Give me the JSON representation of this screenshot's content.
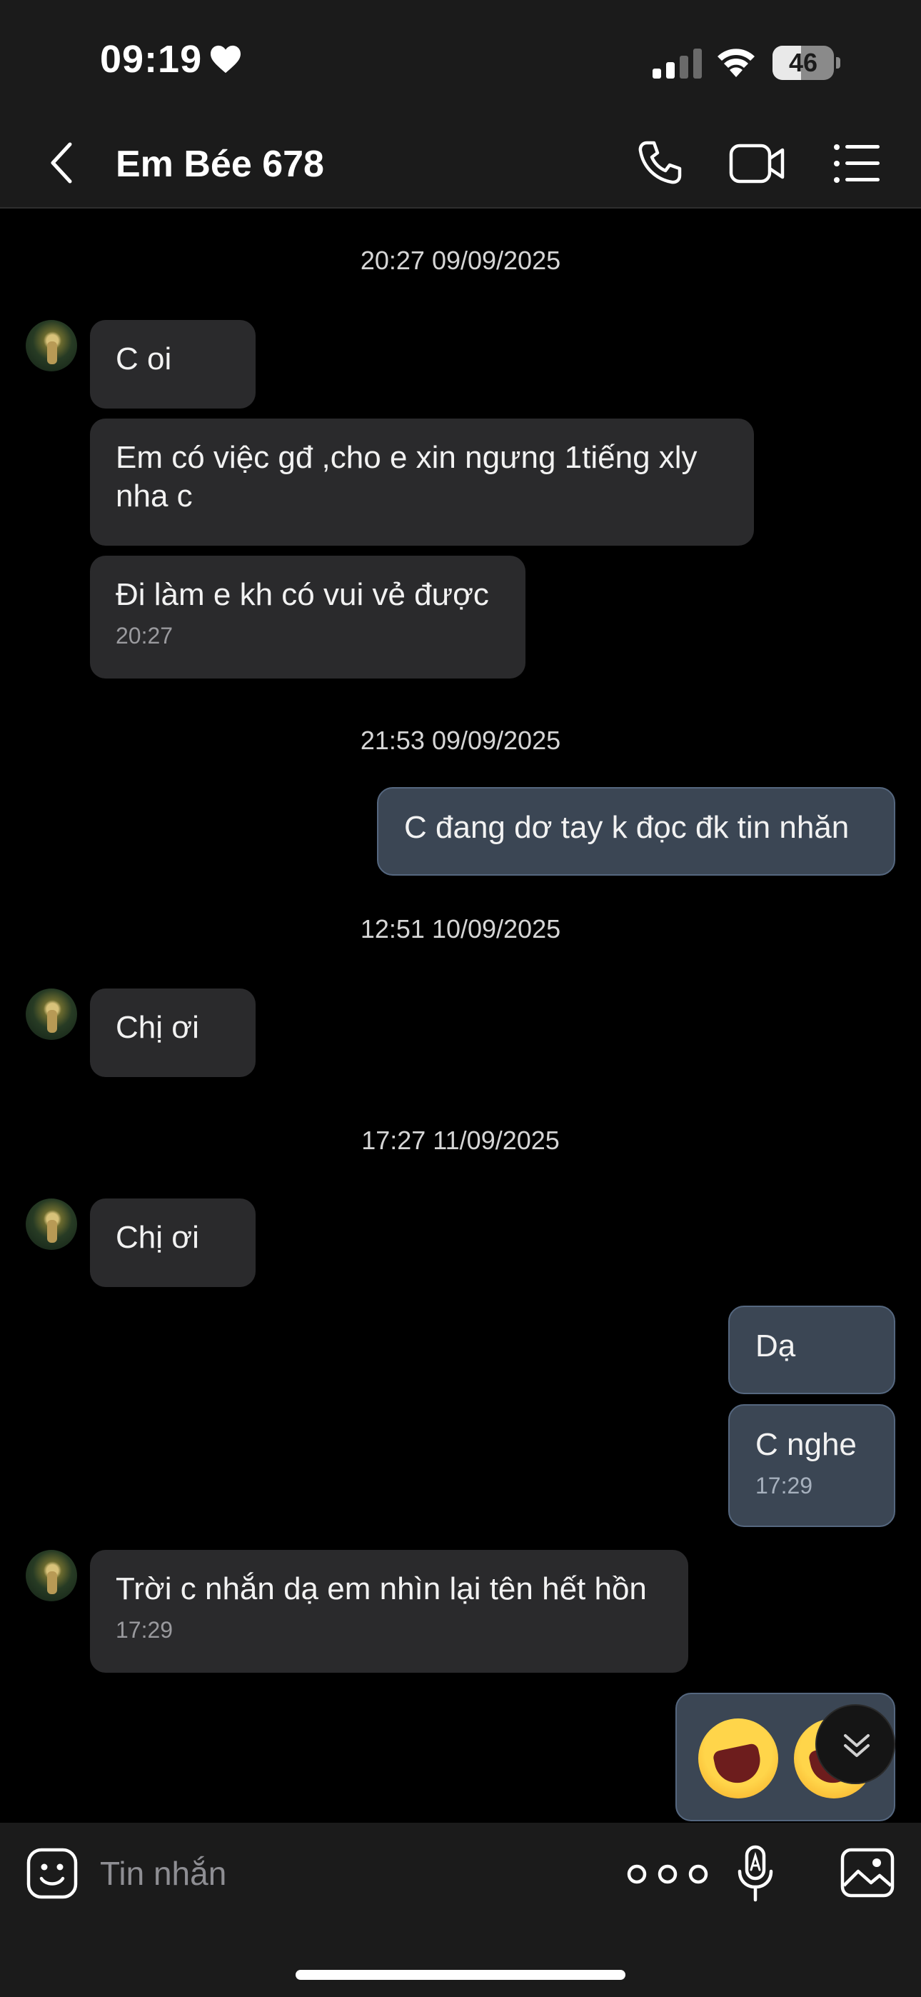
{
  "status_bar": {
    "time": "09:19",
    "battery": "46",
    "battery_level": 0.46
  },
  "header": {
    "title": "Em Bée 678"
  },
  "messages": [
    {
      "divider": "20:27 09/09/2025"
    },
    {
      "text": "C oi"
    },
    {
      "text": "Em có việc gđ ,cho e xin ngưng 1tiếng xly nha c"
    },
    {
      "text": "Đi làm e kh có vui vẻ được",
      "time": "20:27"
    },
    {
      "divider": "21:53 09/09/2025"
    },
    {
      "text": "C đang dơ tay k đọc đk tin nhăn"
    },
    {
      "divider": "12:51 10/09/2025"
    },
    {
      "text": "Chị ơi"
    },
    {
      "divider": "17:27 11/09/2025"
    },
    {
      "text": "Chị ơi"
    },
    {
      "text": "Dạ"
    },
    {
      "text": "C nghe",
      "time": "17:29"
    },
    {
      "text": "Trời c nhắn dạ em nhìn lại tên hết hồn",
      "time": "17:29"
    }
  ],
  "input": {
    "placeholder": "Tin nhắn"
  },
  "icons": {
    "back": "chevron-left-icon",
    "call": "phone-icon",
    "video": "video-camera-icon",
    "menu": "list-icon",
    "sticker": "smiley-icon",
    "more": "ellipsis-icon",
    "mic": "microphone-icon",
    "image": "image-icon",
    "scroll": "chevron-double-down-icon",
    "emoji": "laughing-emoji"
  },
  "colors": {
    "incoming_bubble": "#2a2a2c",
    "outgoing_bubble": "#3b4654",
    "bar": "#1b1b1b"
  }
}
